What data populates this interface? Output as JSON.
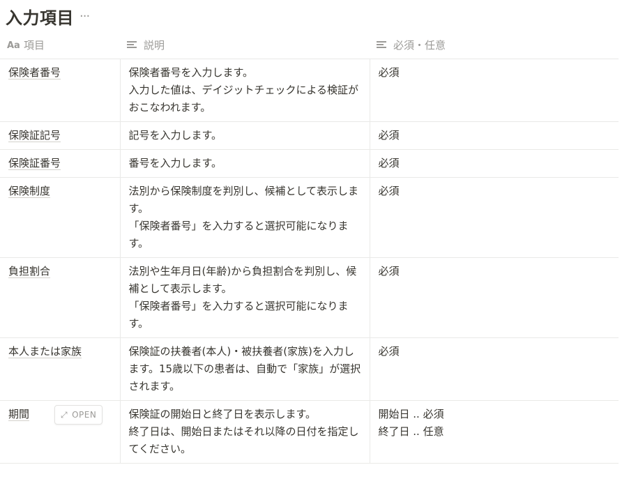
{
  "page": {
    "title": "入力項目",
    "more_icon": "more-horizontal-icon"
  },
  "columns": [
    {
      "label": "項目",
      "icon": "aa-title-icon"
    },
    {
      "label": "説明",
      "icon": "text-lines-icon"
    },
    {
      "label": "必須・任意",
      "icon": "text-lines-icon"
    }
  ],
  "rows": [
    {
      "name": "保険者番号",
      "desc": [
        "保険者番号を入力します。",
        "入力した値は、デイジットチェックによる検証がおこなわれます。"
      ],
      "req": [
        "必須"
      ]
    },
    {
      "name": "保険証記号",
      "desc": [
        "記号を入力します。"
      ],
      "req": [
        "必須"
      ]
    },
    {
      "name": "保険証番号",
      "desc": [
        "番号を入力します。"
      ],
      "req": [
        "必須"
      ]
    },
    {
      "name": "保険制度",
      "desc": [
        "法別から保険制度を判別し、候補として表示します。",
        "「保険者番号」を入力すると選択可能になります。"
      ],
      "req": [
        "必須"
      ]
    },
    {
      "name": "負担割合",
      "desc": [
        "法別や生年月日(年齢)から負担割合を判別し、候補として表示します。",
        "「保険者番号」を入力すると選択可能になります。"
      ],
      "req": [
        "必須"
      ]
    },
    {
      "name": "本人または家族",
      "desc": [
        "保険証の扶養者(本人)・被扶養者(家族)を入力します。15歳以下の患者は、自動で「家族」が選択されます。"
      ],
      "req": [
        "必須"
      ]
    },
    {
      "name": "期間",
      "desc": [
        "保険証の開始日と終了日を表示します。",
        "終了日は、開始日またはそれ以降の日付を指定してください。"
      ],
      "req": [
        "開始日 .. 必須",
        "終了日 .. 任意"
      ]
    }
  ],
  "open_button": {
    "label": "OPEN",
    "icon": "expand-diagonal-icon"
  }
}
